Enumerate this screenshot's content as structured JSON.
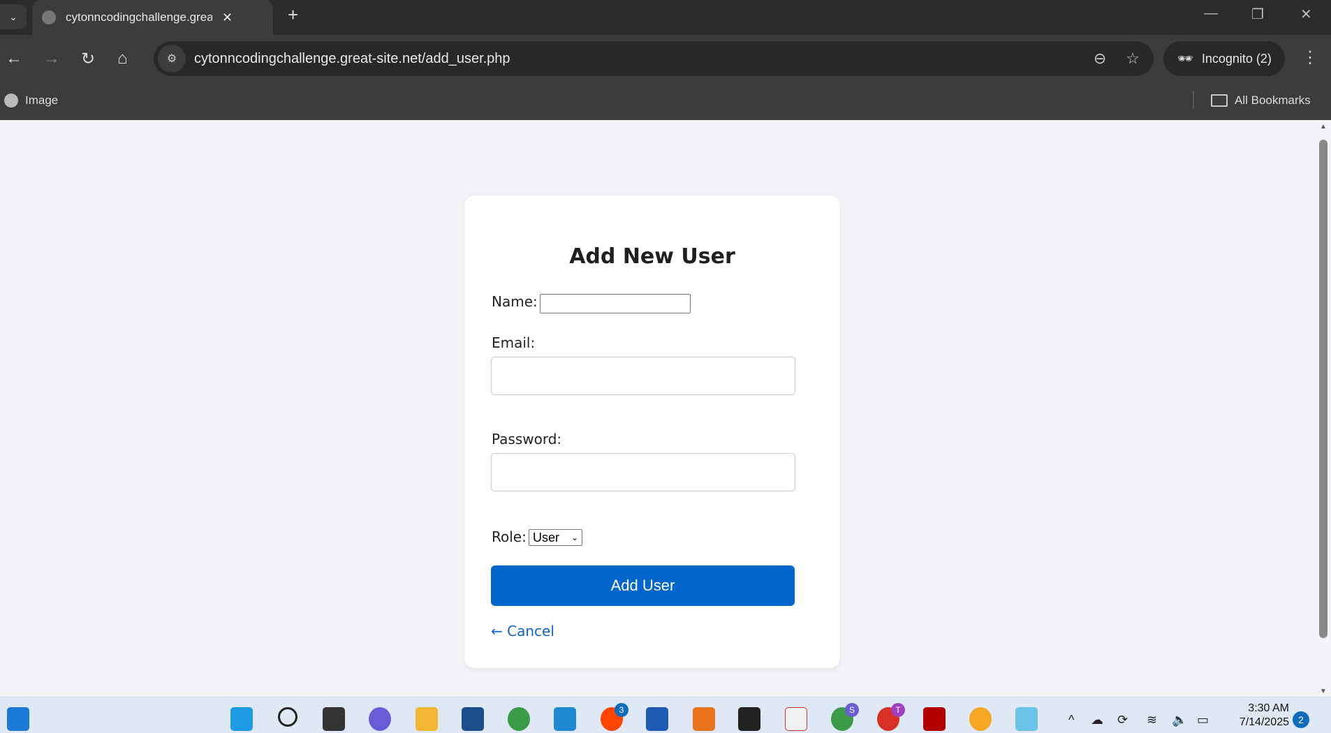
{
  "browser": {
    "tab_title": "cytonncodingchallenge.great-site.net",
    "url": "cytonncodingchallenge.great-site.net/add_user.php",
    "incognito_label": "Incognito (2)",
    "bookmark_item": "Image",
    "all_bookmarks": "All Bookmarks"
  },
  "form": {
    "title": "Add New User",
    "name_label": "Name:",
    "name_value": "",
    "email_label": "Email:",
    "email_value": "",
    "password_label": "Password:",
    "password_value": "",
    "role_label": "Role:",
    "role_selected": "User",
    "submit_label": "Add User",
    "cancel_label": "← Cancel",
    "accent_color": "#0366cc"
  },
  "taskbar": {
    "reddit_badge": "3",
    "chrome_profile_s": "S",
    "chrome_profile_t": "T",
    "time": "3:30 AM",
    "date": "7/14/2025",
    "notifications": "2"
  }
}
